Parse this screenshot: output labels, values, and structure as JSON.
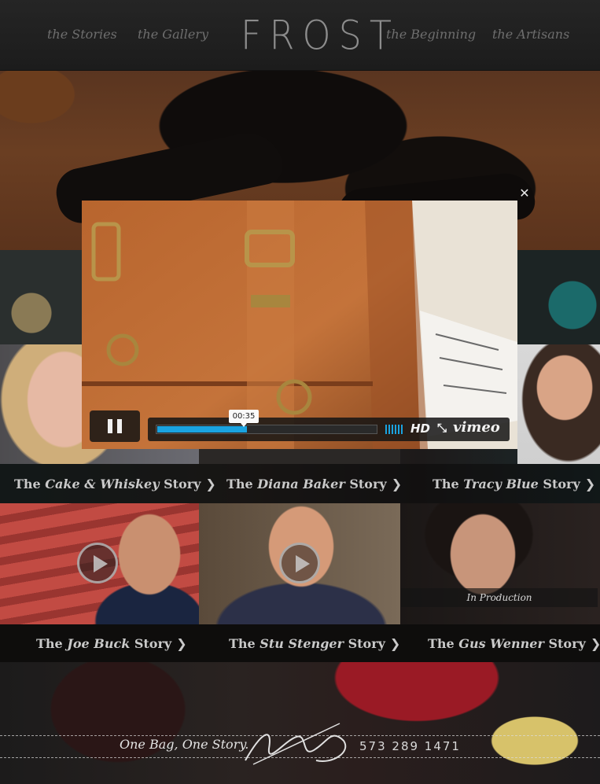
{
  "header": {
    "logo": "FROST",
    "nav": [
      {
        "label": "the Stories"
      },
      {
        "label": "the Gallery"
      },
      {
        "label": "the Beginning"
      },
      {
        "label": "the Artisans"
      }
    ]
  },
  "video_player": {
    "timecode": "00:35",
    "progress": 0.41,
    "hd_label": "HD",
    "brand": "vimeo",
    "close_icon": "close-icon",
    "pause_icon": "pause-icon",
    "fullscreen_icon": "fullscreen-icon"
  },
  "stories_row1": [
    {
      "prefix": "The ",
      "name": "Cake & Whiskey",
      "suffix": " Story",
      "arrow": "❯"
    },
    {
      "prefix": "The ",
      "name": "Diana Baker",
      "suffix": " Story",
      "arrow": "❯"
    },
    {
      "prefix": "The ",
      "name": "Tracy Blue",
      "suffix": " Story",
      "arrow": "❯"
    }
  ],
  "stories_row2": [
    {
      "prefix": "The ",
      "name": "Joe Buck",
      "suffix": " Story",
      "arrow": "❯"
    },
    {
      "prefix": "The ",
      "name": "Stu Stenger",
      "suffix": " Story",
      "arrow": "❯"
    },
    {
      "prefix": "The ",
      "name": "Gus Wenner",
      "suffix": " Story",
      "arrow": "❯"
    }
  ],
  "in_production": "In Production",
  "footer": {
    "tagline": "One Bag, One Story.",
    "phone": "573 289 1471"
  },
  "colors": {
    "accent_blue": "#1aa3e0",
    "header_bg": "#1f1f1f",
    "caption_text": "#c9c9c9"
  }
}
